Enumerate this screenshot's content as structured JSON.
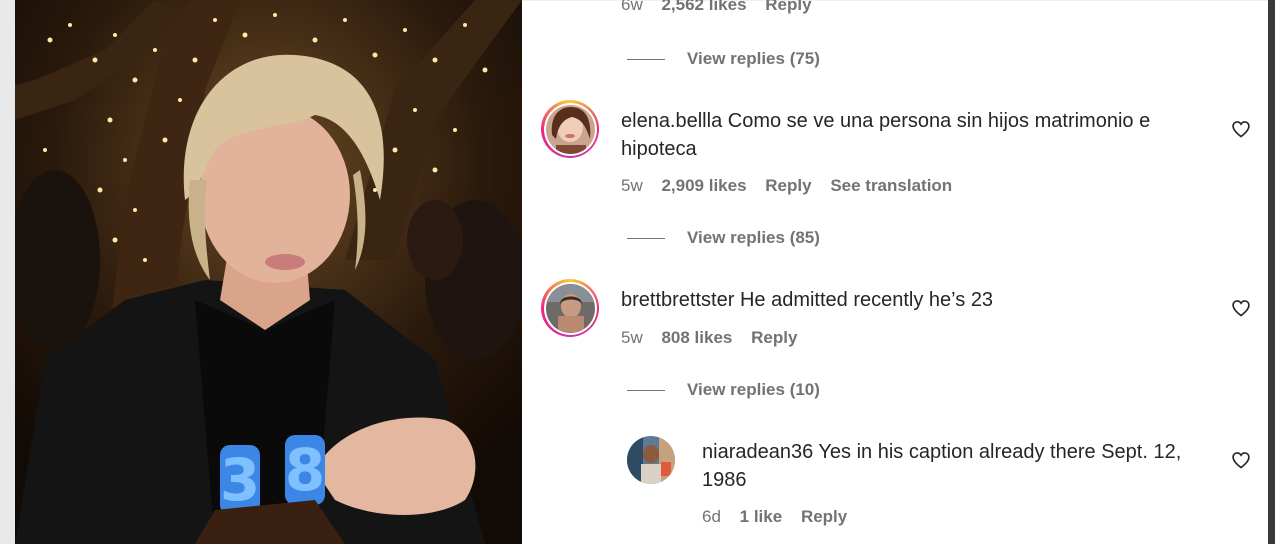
{
  "post": {
    "photo_alt_label": "birthday candles 38"
  },
  "comments": [
    {
      "meta": {
        "time": "6w",
        "likes": "2,562 likes",
        "reply": "Reply"
      },
      "view_replies": "View replies (75)"
    },
    {
      "username": "elena.bellla",
      "text": "Como se ve una persona sin hijos matrimonio e",
      "text_line2": "hipoteca",
      "meta": {
        "time": "5w",
        "likes": "2,909 likes",
        "reply": "Reply",
        "translate": "See translation"
      },
      "view_replies": "View replies (85)"
    },
    {
      "username": "brettbrettster",
      "text": "He admitted recently he’s 23",
      "meta": {
        "time": "5w",
        "likes": "808 likes",
        "reply": "Reply"
      },
      "view_replies": "View replies (10)"
    }
  ],
  "reply": {
    "username": "niaradean36",
    "text": "Yes in his caption already there Sept. 12,",
    "text_line2": "1986",
    "meta": {
      "time": "6d",
      "likes": "1 like",
      "reply": "Reply"
    }
  },
  "colors": {
    "text_primary": "#262626",
    "text_secondary": "#737373",
    "ring_gradient": [
      "#f9ce34",
      "#ee2a7b",
      "#c837ab"
    ]
  }
}
